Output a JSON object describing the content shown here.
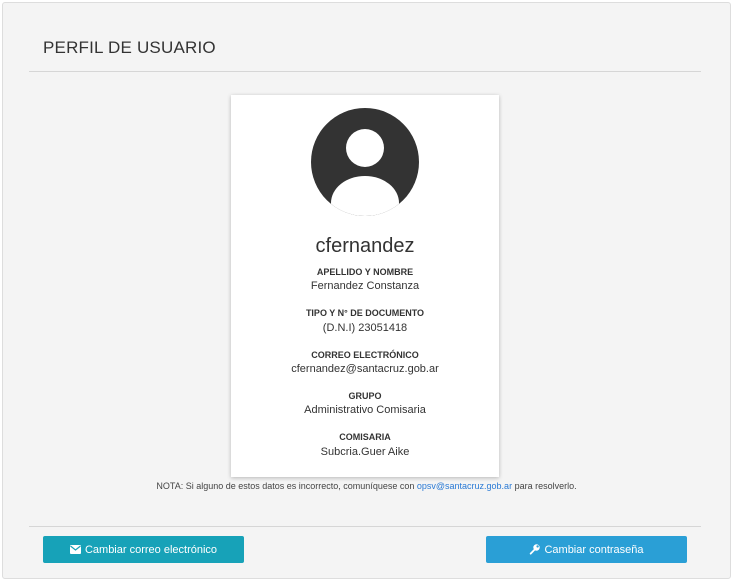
{
  "page": {
    "title": "PERFIL DE USUARIO"
  },
  "profile": {
    "avatar_icon": "user-circle-icon",
    "username": "cfernandez",
    "fields": [
      {
        "label": "APELLIDO Y NOMBRE",
        "value": "Fernandez Constanza"
      },
      {
        "label": "TIPO Y N° DE DOCUMENTO",
        "value": "(D.N.I) 23051418"
      },
      {
        "label": "CORREO ELECTRÓNICO",
        "value": "cfernandez@santacruz.gob.ar"
      },
      {
        "label": "GRUPO",
        "value": "Administrativo Comisaria"
      },
      {
        "label": "COMISARIA",
        "value": "Subcria.Guer Aike"
      }
    ]
  },
  "note": {
    "prefix": "NOTA: Si alguno de estos datos es incorrecto, comuníquese con",
    "email": "opsv@santacruz.gob.ar",
    "suffix": "para resolverlo."
  },
  "actions": {
    "change_email": {
      "label": "Cambiar correo electrónico",
      "icon": "envelope-icon"
    },
    "change_password": {
      "label": "Cambiar contraseña",
      "icon": "wrench-icon"
    }
  },
  "colors": {
    "email_button": "#17a2b8",
    "password_button": "#2a9fd6",
    "avatar": "#333333",
    "link": "#2a7ad5"
  }
}
